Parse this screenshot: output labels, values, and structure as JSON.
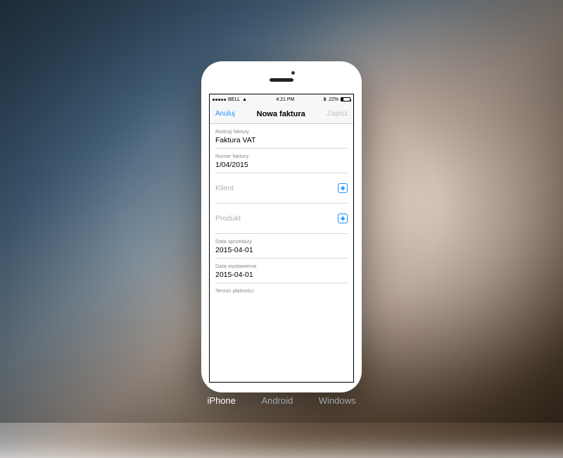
{
  "statusbar": {
    "carrier": "BELL",
    "time": "4:21 PM",
    "battery_pct": "22%"
  },
  "navbar": {
    "left": "Anuluj",
    "title": "Nowa faktura",
    "right": "Zapisz"
  },
  "form": {
    "invoice_type": {
      "label": "Rodzaj faktury",
      "value": "Faktura VAT"
    },
    "invoice_number": {
      "label": "Numer faktury",
      "value": "1/04/2015"
    },
    "client": {
      "label": "Klient"
    },
    "product": {
      "label": "Produkt"
    },
    "sale_date": {
      "label": "Data sprzedaży",
      "value": "2015-04-01"
    },
    "issue_date": {
      "label": "Data wystawienia",
      "value": "2015-04-01"
    },
    "payment_due": {
      "label": "Termin płatności"
    }
  },
  "tabs": {
    "iphone": "iPhone",
    "android": "Android",
    "windows": "Windows"
  }
}
